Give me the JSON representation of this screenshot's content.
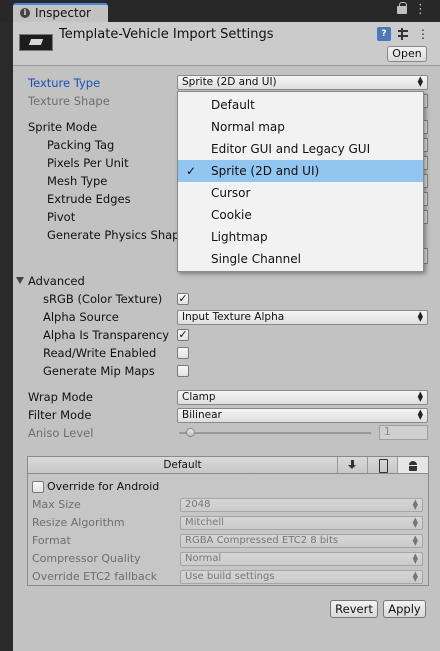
{
  "tab": {
    "label": "Inspector",
    "icon": "info-icon"
  },
  "header": {
    "title": "Template-Vehicle Import Settings",
    "open_label": "Open"
  },
  "fields": {
    "texture_type": {
      "label": "Texture Type",
      "value": "Sprite (2D and UI)"
    },
    "texture_shape": {
      "label": "Texture Shape"
    },
    "sprite_mode": {
      "label": "Sprite Mode"
    },
    "packing_tag": {
      "label": "Packing Tag"
    },
    "pixels_per_unit": {
      "label": "Pixels Per Unit"
    },
    "mesh_type": {
      "label": "Mesh Type"
    },
    "extrude_edges": {
      "label": "Extrude Edges"
    },
    "pivot": {
      "label": "Pivot"
    },
    "generate_physics_shape": {
      "label": "Generate Physics Shap"
    }
  },
  "advanced": {
    "label": "Advanced",
    "srgb": {
      "label": "sRGB (Color Texture)",
      "checked": true
    },
    "alpha_source": {
      "label": "Alpha Source",
      "value": "Input Texture Alpha"
    },
    "alpha_is_transparency": {
      "label": "Alpha Is Transparency",
      "checked": true
    },
    "read_write": {
      "label": "Read/Write Enabled",
      "checked": false
    },
    "mip_maps": {
      "label": "Generate Mip Maps",
      "checked": false
    }
  },
  "wrap_mode": {
    "label": "Wrap Mode",
    "value": "Clamp"
  },
  "filter_mode": {
    "label": "Filter Mode",
    "value": "Bilinear"
  },
  "aniso_level": {
    "label": "Aniso Level",
    "value": "1"
  },
  "platform": {
    "default_tab": "Default",
    "override": {
      "label": "Override for Android",
      "checked": false
    },
    "max_size": {
      "label": "Max Size",
      "value": "2048"
    },
    "resize_algorithm": {
      "label": "Resize Algorithm",
      "value": "Mitchell"
    },
    "format": {
      "label": "Format",
      "value": "RGBA Compressed ETC2 8 bits"
    },
    "compressor_quality": {
      "label": "Compressor Quality",
      "value": "Normal"
    },
    "etc2_fallback": {
      "label": "Override ETC2 fallback",
      "value": "Use build settings"
    }
  },
  "buttons": {
    "revert": "Revert",
    "apply": "Apply"
  },
  "popup": {
    "items": [
      "Default",
      "Normal map",
      "Editor GUI and Legacy GUI",
      "Sprite (2D and UI)",
      "Cursor",
      "Cookie",
      "Lightmap",
      "Single Channel"
    ],
    "selected": "Sprite (2D and UI)",
    "check": "✓"
  },
  "colors": {
    "selection": "#92c5ef",
    "label_accent": "#1b4fb7",
    "panel": "#c2c2c2"
  }
}
